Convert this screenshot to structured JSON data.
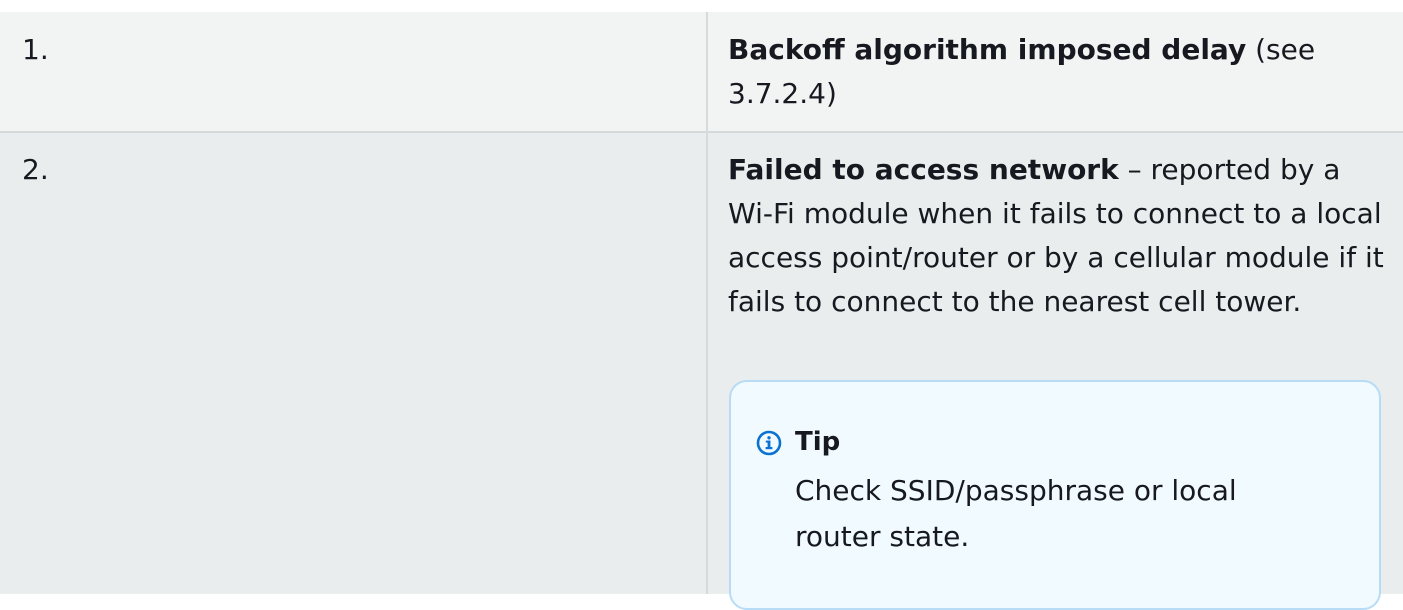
{
  "rows": [
    {
      "number": "1.",
      "title": "Backoff algorithm imposed delay",
      "text": " (see 3.7.2.4)"
    },
    {
      "number": "2.",
      "title": "Failed to access network",
      "text": " – reported by a Wi-Fi module when it fails to connect to a local access point/router or by a cellular module if it fails to connect to the nearest cell tower."
    }
  ],
  "tip": {
    "title": "Tip",
    "icon": "info-icon",
    "body": "Check SSID/passphrase or local router state.",
    "accent_color": "#0972d3"
  }
}
